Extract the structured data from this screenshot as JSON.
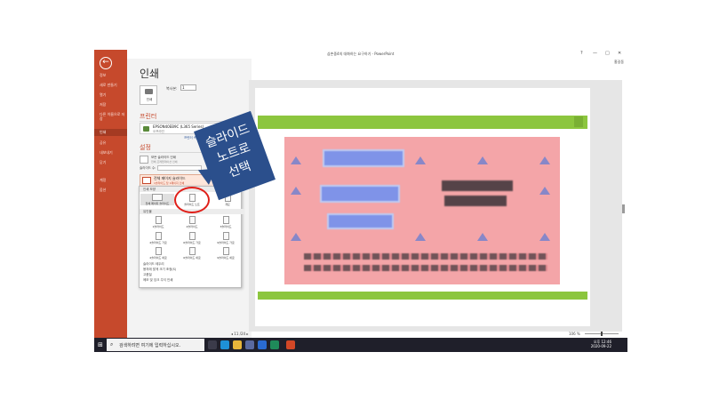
{
  "window": {
    "title": "삼촌중4의 대화하는 요구하기 - PowerPoint",
    "user": "홍길동",
    "controls": [
      "?",
      "—",
      "□",
      "✕"
    ]
  },
  "sidebar": {
    "items": [
      {
        "label": "정보"
      },
      {
        "label": "새로 만들기"
      },
      {
        "label": "열기"
      },
      {
        "label": "저장"
      },
      {
        "label": "다른 이름으로 저장"
      },
      {
        "label": "인쇄"
      },
      {
        "label": "공유"
      },
      {
        "label": "내보내기"
      },
      {
        "label": "닫기"
      },
      {
        "label": "계정"
      },
      {
        "label": "옵션"
      }
    ]
  },
  "print": {
    "heading": "인쇄",
    "print_button": "인쇄",
    "copies_label": "복사본:",
    "copies_value": "1",
    "printer_header": "프린터",
    "printer_name": "EPSON40EB9C (L365 Series)",
    "printer_status": "오프라인",
    "printer_props": "프린터 속성",
    "settings_header": "설정",
    "opt_all_slides": "모든 슬라이드 인쇄",
    "opt_all_slides_sub": "전체 프레젠테이션 인쇄",
    "slides_label": "슬라이드 수:",
    "layout_selected": "전체 페이지 슬라이드",
    "layout_selected_sub": "1슬라이드 당 1페이지 인쇄"
  },
  "layout_popup": {
    "section_print_layout": "인쇄 모양",
    "full_page": "전체 페이지 슬라이드",
    "notes": "슬라이드 노트",
    "outline": "개요",
    "section_handouts": "유인물",
    "handouts": [
      "1슬라이드",
      "2슬라이드",
      "3슬라이드",
      "4슬라이드 가로",
      "6슬라이드 가로",
      "9슬라이드 가로",
      "4슬라이드 세로",
      "6슬라이드 세로",
      "9슬라이드 세로"
    ],
    "frame_slides": "슬라이드 테두리",
    "scale_to_fit": "용지에 맞게 크기 조정(S)",
    "high_quality": "고품질",
    "print_comments": "메모 및 잉크 주석 인쇄"
  },
  "callout": {
    "line1": "슬라이드",
    "line2": "노트로",
    "line3": "선택"
  },
  "preview": {
    "page_current": "11",
    "page_total": "/24",
    "zoom": "106 %"
  },
  "taskbar": {
    "search_placeholder": "검색하려면 여기에 입력하십시오.",
    "time": "오후 12:46",
    "date": "2020-09-22"
  },
  "colors": {
    "backstage_red": "#c6492c",
    "accent_green": "#8cc63e",
    "callout_blue": "#2b4f8c",
    "circle_red": "#e0201a"
  }
}
